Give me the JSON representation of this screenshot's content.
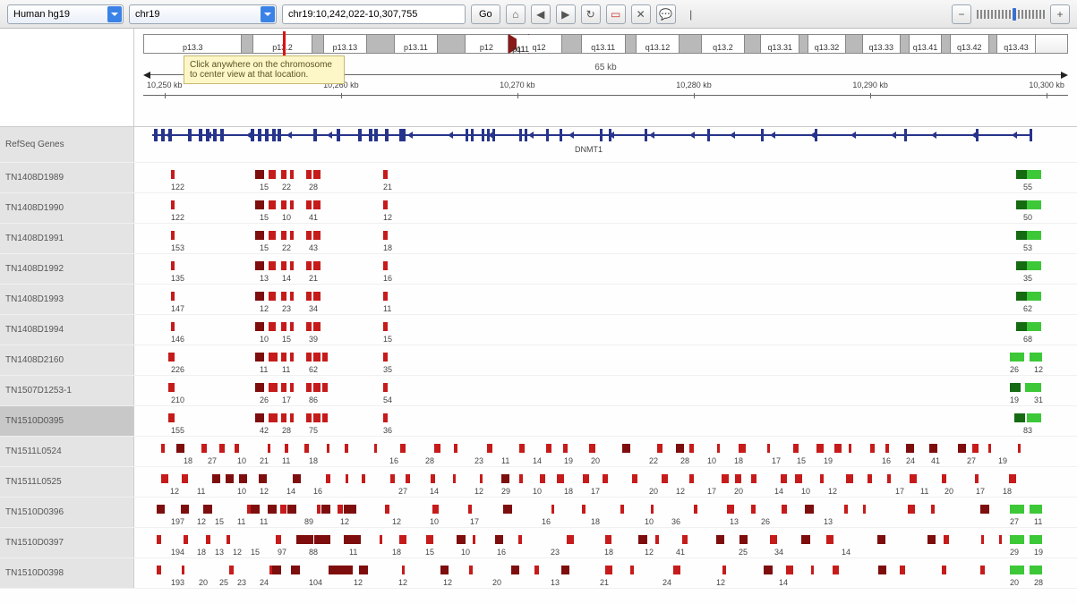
{
  "genome": "Human hg19",
  "chromosome": "chr19",
  "locus": "chr19:10,242,022-10,307,755",
  "go_label": "Go",
  "tooltip_text": "Click anywhere on the chromosome to center view at that location.",
  "range_label": "65 kb",
  "ruler_ticks": [
    "10,250 kb",
    "10,260 kb",
    "10,270 kb",
    "10,280 kb",
    "10,290 kb",
    "10,300 kb"
  ],
  "ideogram_bands": [
    {
      "label": "p13.3",
      "w": 90,
      "shade": "light"
    },
    {
      "label": "",
      "w": 10,
      "shade": "dark"
    },
    {
      "label": "p13.2",
      "w": 55,
      "shade": "light"
    },
    {
      "label": "",
      "w": 10,
      "shade": "dark"
    },
    {
      "label": "p13.13",
      "w": 40,
      "shade": "light"
    },
    {
      "label": "",
      "w": 25,
      "shade": "dark"
    },
    {
      "label": "p13.11",
      "w": 40,
      "shade": "light"
    },
    {
      "label": "",
      "w": 25,
      "shade": "dark"
    },
    {
      "label": "p12",
      "w": 40,
      "shade": "light"
    },
    {
      "label": "p11",
      "w": 0,
      "shade": "cen-l"
    },
    {
      "label": "q11",
      "w": 0,
      "shade": "cen-r"
    },
    {
      "label": "q12",
      "w": 42,
      "shade": "light"
    },
    {
      "label": "",
      "w": 18,
      "shade": "dark"
    },
    {
      "label": "q13.11",
      "w": 40,
      "shade": "light"
    },
    {
      "label": "",
      "w": 10,
      "shade": "dark"
    },
    {
      "label": "q13.12",
      "w": 40,
      "shade": "light"
    },
    {
      "label": "",
      "w": 20,
      "shade": "dark"
    },
    {
      "label": "q13.2",
      "w": 40,
      "shade": "light"
    },
    {
      "label": "",
      "w": 15,
      "shade": "dark"
    },
    {
      "label": "q13.31",
      "w": 35,
      "shade": "light"
    },
    {
      "label": "",
      "w": 8,
      "shade": "dark"
    },
    {
      "label": "q13.32",
      "w": 35,
      "shade": "light"
    },
    {
      "label": "",
      "w": 15,
      "shade": "dark"
    },
    {
      "label": "q13.33",
      "w": 35,
      "shade": "light"
    },
    {
      "label": "",
      "w": 8,
      "shade": "dark"
    },
    {
      "label": "q13.41",
      "w": 30,
      "shade": "light"
    },
    {
      "label": "",
      "w": 8,
      "shade": "dark"
    },
    {
      "label": "q13.42",
      "w": 35,
      "shade": "light"
    },
    {
      "label": "",
      "w": 8,
      "shade": "dark"
    },
    {
      "label": "q13.43",
      "w": 35,
      "shade": "light"
    }
  ],
  "ideogram_marker_pct": 15,
  "refseq_label": "RefSeq Genes",
  "gene_name": "DNMT1",
  "tracks": [
    {
      "name": "TN1408D1989",
      "style": "sparse",
      "nums": [
        "122",
        "15",
        "22",
        "28",
        "21",
        "55"
      ],
      "numx": [
        41,
        140,
        165,
        195,
        278,
        993
      ],
      "bars": [
        [
          41,
          4
        ],
        [
          135,
          10
        ],
        [
          150,
          8
        ],
        [
          164,
          6
        ],
        [
          174,
          4
        ],
        [
          192,
          6
        ],
        [
          200,
          8
        ],
        [
          278,
          5
        ]
      ],
      "green": [
        [
          985,
          12
        ],
        [
          997,
          16
        ]
      ]
    },
    {
      "name": "TN1408D1990",
      "style": "sparse",
      "nums": [
        "122",
        "15",
        "10",
        "41",
        "12",
        "50"
      ],
      "numx": [
        41,
        140,
        165,
        195,
        278,
        993
      ],
      "bars": [
        [
          41,
          4
        ],
        [
          135,
          10
        ],
        [
          150,
          8
        ],
        [
          164,
          6
        ],
        [
          174,
          4
        ],
        [
          192,
          6
        ],
        [
          200,
          8
        ],
        [
          278,
          5
        ]
      ],
      "green": [
        [
          985,
          12
        ],
        [
          997,
          16
        ]
      ]
    },
    {
      "name": "TN1408D1991",
      "style": "sparse",
      "nums": [
        "153",
        "15",
        "22",
        "43",
        "18",
        "53"
      ],
      "numx": [
        41,
        140,
        165,
        195,
        278,
        993
      ],
      "bars": [
        [
          41,
          4
        ],
        [
          135,
          10
        ],
        [
          150,
          8
        ],
        [
          164,
          6
        ],
        [
          174,
          4
        ],
        [
          192,
          6
        ],
        [
          200,
          8
        ],
        [
          278,
          5
        ]
      ],
      "green": [
        [
          985,
          12
        ],
        [
          997,
          16
        ]
      ]
    },
    {
      "name": "TN1408D1992",
      "style": "sparse",
      "nums": [
        "135",
        "13",
        "14",
        "21",
        "16",
        "35"
      ],
      "numx": [
        41,
        140,
        165,
        195,
        278,
        993
      ],
      "bars": [
        [
          41,
          4
        ],
        [
          135,
          10
        ],
        [
          150,
          8
        ],
        [
          164,
          6
        ],
        [
          174,
          4
        ],
        [
          192,
          6
        ],
        [
          200,
          8
        ],
        [
          278,
          5
        ]
      ],
      "green": [
        [
          985,
          12
        ],
        [
          997,
          16
        ]
      ]
    },
    {
      "name": "TN1408D1993",
      "style": "sparse",
      "nums": [
        "147",
        "12",
        "23",
        "34",
        "11",
        "62"
      ],
      "numx": [
        41,
        140,
        165,
        195,
        278,
        993
      ],
      "bars": [
        [
          41,
          4
        ],
        [
          135,
          10
        ],
        [
          150,
          8
        ],
        [
          164,
          6
        ],
        [
          174,
          4
        ],
        [
          192,
          6
        ],
        [
          200,
          8
        ],
        [
          278,
          5
        ]
      ],
      "green": [
        [
          985,
          12
        ],
        [
          997,
          16
        ]
      ]
    },
    {
      "name": "TN1408D1994",
      "style": "sparse",
      "nums": [
        "146",
        "10",
        "15",
        "39",
        "15",
        "68"
      ],
      "numx": [
        41,
        140,
        165,
        195,
        278,
        993
      ],
      "bars": [
        [
          41,
          4
        ],
        [
          135,
          10
        ],
        [
          150,
          8
        ],
        [
          164,
          6
        ],
        [
          174,
          4
        ],
        [
          192,
          6
        ],
        [
          200,
          8
        ],
        [
          278,
          5
        ]
      ],
      "green": [
        [
          985,
          12
        ],
        [
          997,
          16
        ]
      ]
    },
    {
      "name": "TN1408D2160",
      "style": "sparse",
      "nums": [
        "226",
        "11",
        "11",
        "62",
        "35",
        "26",
        "12"
      ],
      "numx": [
        41,
        140,
        165,
        195,
        278,
        978,
        1005
      ],
      "bars": [
        [
          38,
          6
        ],
        [
          41,
          4
        ],
        [
          135,
          10
        ],
        [
          150,
          8
        ],
        [
          156,
          4
        ],
        [
          164,
          6
        ],
        [
          174,
          4
        ],
        [
          192,
          6
        ],
        [
          200,
          8
        ],
        [
          210,
          6
        ],
        [
          278,
          5
        ]
      ],
      "green": [
        [
          978,
          16
        ],
        [
          1000,
          14
        ]
      ]
    },
    {
      "name": "TN1507D1253-1",
      "style": "sparse",
      "nums": [
        "210",
        "26",
        "17",
        "86",
        "54",
        "19",
        "31"
      ],
      "numx": [
        41,
        140,
        165,
        195,
        278,
        978,
        1005
      ],
      "bars": [
        [
          38,
          6
        ],
        [
          41,
          4
        ],
        [
          135,
          10
        ],
        [
          150,
          8
        ],
        [
          156,
          4
        ],
        [
          164,
          6
        ],
        [
          174,
          4
        ],
        [
          192,
          6
        ],
        [
          200,
          8
        ],
        [
          210,
          6
        ],
        [
          278,
          5
        ]
      ],
      "green": [
        [
          978,
          12
        ],
        [
          995,
          18
        ]
      ]
    },
    {
      "name": "TN1510D0395",
      "style": "sparse",
      "active": true,
      "nums": [
        "155",
        "42",
        "28",
        "75",
        "36",
        "83"
      ],
      "numx": [
        41,
        140,
        165,
        195,
        278,
        993
      ],
      "bars": [
        [
          38,
          6
        ],
        [
          41,
          4
        ],
        [
          135,
          10
        ],
        [
          150,
          8
        ],
        [
          156,
          4
        ],
        [
          164,
          6
        ],
        [
          174,
          4
        ],
        [
          192,
          6
        ],
        [
          200,
          8
        ],
        [
          210,
          6
        ],
        [
          278,
          5
        ]
      ],
      "green": [
        [
          983,
          12
        ],
        [
          997,
          16
        ]
      ]
    },
    {
      "name": "TN1511L0524",
      "style": "dense",
      "nums": [
        "18",
        "27",
        "10",
        "21",
        "11",
        "18",
        "16",
        "28",
        "23",
        "11",
        "14",
        "19",
        "20",
        "22",
        "28",
        "10",
        "18",
        "17",
        "15",
        "19",
        "16",
        "24",
        "41",
        "27",
        "19"
      ],
      "numx": [
        55,
        82,
        115,
        140,
        165,
        195,
        285,
        325,
        380,
        410,
        445,
        480,
        510,
        575,
        610,
        640,
        670,
        712,
        740,
        770,
        835,
        862,
        890,
        930,
        965
      ],
      "green": []
    },
    {
      "name": "TN1511L0525",
      "style": "dense",
      "nums": [
        "12",
        "11",
        "10",
        "12",
        "14",
        "16",
        "27",
        "14",
        "12",
        "29",
        "10",
        "18",
        "17",
        "20",
        "12",
        "17",
        "20",
        "14",
        "10",
        "12",
        "17",
        "11",
        "20",
        "17",
        "18"
      ],
      "numx": [
        40,
        70,
        115,
        140,
        170,
        200,
        295,
        330,
        380,
        410,
        445,
        480,
        510,
        575,
        605,
        640,
        670,
        715,
        745,
        775,
        850,
        878,
        905,
        940,
        970
      ],
      "green": []
    },
    {
      "name": "TN1510D0396",
      "style": "mixed",
      "nums": [
        "197",
        "12",
        "15",
        "11",
        "11",
        "89",
        "12",
        "12",
        "10",
        "17",
        "16",
        "18",
        "10",
        "36",
        "13",
        "26",
        "13",
        "27",
        "11"
      ],
      "numx": [
        41,
        70,
        90,
        115,
        140,
        190,
        230,
        288,
        330,
        375,
        455,
        510,
        570,
        600,
        665,
        700,
        770,
        978,
        1005
      ],
      "green": [
        [
          978,
          16
        ],
        [
          1000,
          14
        ]
      ]
    },
    {
      "name": "TN1510D0397",
      "style": "mixed",
      "nums": [
        "194",
        "18",
        "13",
        "12",
        "15",
        "97",
        "88",
        "11",
        "18",
        "15",
        "10",
        "16",
        "23",
        "18",
        "12",
        "41",
        "25",
        "34",
        "14",
        "29",
        "19"
      ],
      "numx": [
        41,
        70,
        90,
        110,
        130,
        160,
        195,
        240,
        288,
        325,
        365,
        405,
        465,
        525,
        570,
        605,
        675,
        715,
        790,
        978,
        1005
      ],
      "green": [
        [
          978,
          16
        ],
        [
          1000,
          14
        ]
      ]
    },
    {
      "name": "TN1510D0398",
      "style": "mixed",
      "nums": [
        "193",
        "20",
        "25",
        "23",
        "24",
        "104",
        "12",
        "12",
        "12",
        "20",
        "13",
        "21",
        "24",
        "12",
        "14",
        "20",
        "28"
      ],
      "numx": [
        41,
        72,
        95,
        115,
        140,
        195,
        245,
        295,
        345,
        400,
        465,
        520,
        590,
        650,
        720,
        978,
        1005
      ],
      "green": [
        [
          978,
          16
        ],
        [
          1000,
          14
        ]
      ]
    }
  ]
}
